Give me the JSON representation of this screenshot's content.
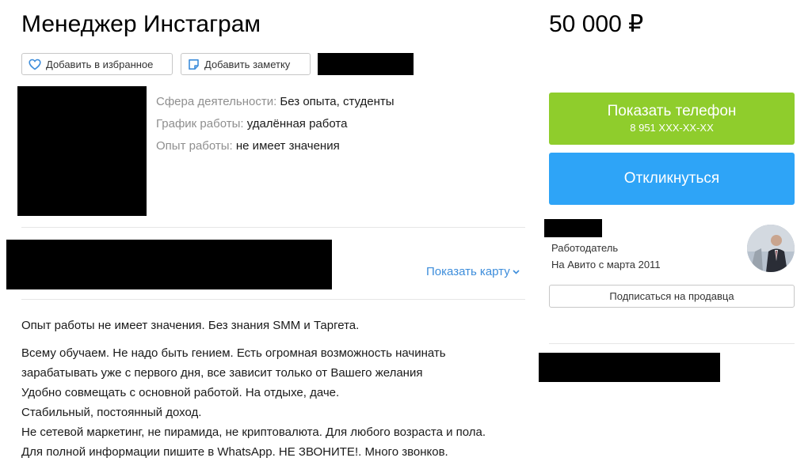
{
  "ad": {
    "title": "Менеджер Инстаграм",
    "price": "50 000 ₽"
  },
  "actions": {
    "favorite_label": "Добавить в избранное",
    "note_label": "Добавить заметку"
  },
  "params": [
    {
      "label": "Сфера деятельности:",
      "value": "Без опыта, студенты"
    },
    {
      "label": "График работы:",
      "value": "удалённая работа"
    },
    {
      "label": "Опыт работы:",
      "value": "не имеет значения"
    }
  ],
  "location": {
    "show_map_label": "Показать карту"
  },
  "description": [
    "Опыт работы не имеет значения. Без знания SMM и Таргета.",
    "Всему обучаем. Не надо быть гением. Есть огромная возможность начинать",
    "зарабатывать уже с первого дня, все зависит только от Вашего желания",
    "Удобно совмещать с основной работой. На отдыхе, даче.",
    "Стабильный, постоянный доход.",
    "Не сетевой маркетинг, не пирамида, не криптовалюта. Для любого возраста и пола.",
    "Для полной информации пишите в WhatsApp. НЕ ЗВОНИТЕ!. Много звонков."
  ],
  "contact": {
    "show_phone_label": "Показать телефон",
    "phone_masked": "8 951 XXX-XX-XX",
    "respond_label": "Откликнуться"
  },
  "seller": {
    "role": "Работодатель",
    "since": "На Авито с марта 2011",
    "subscribe_label": "Подписаться на продавца"
  },
  "colors": {
    "phone_button": "#8fcd2c",
    "respond_button": "#2ea4f7",
    "link": "#3d8ddb"
  },
  "icons": {
    "favorite": "heart-icon",
    "note": "note-icon",
    "map_toggle": "chevron-down-icon"
  }
}
